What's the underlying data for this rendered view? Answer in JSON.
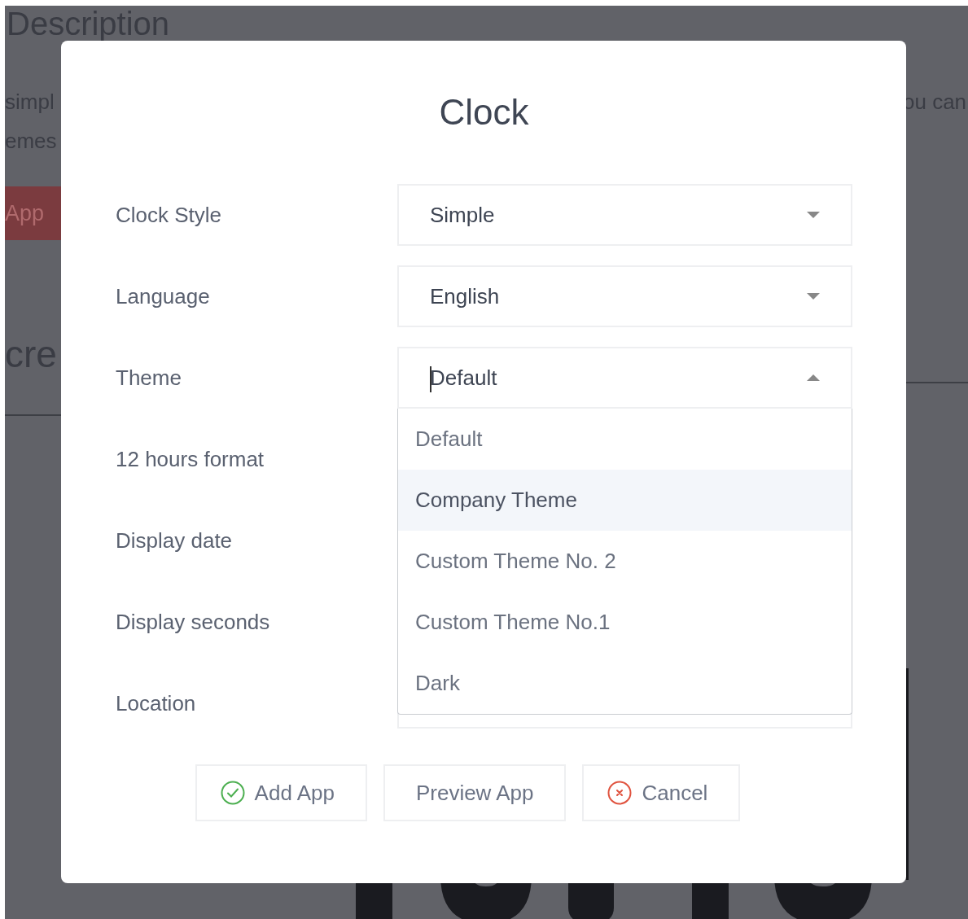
{
  "background": {
    "heading": "Description",
    "left_texts": [
      "simpl",
      "emes"
    ],
    "button": "App",
    "subheading": "cre",
    "right_text": "ou can"
  },
  "dialog": {
    "title": "Clock",
    "rows": [
      {
        "label": "Clock Style",
        "field": {
          "kind": "select",
          "value": "Simple",
          "open": false
        }
      },
      {
        "label": "Language",
        "field": {
          "kind": "select",
          "value": "English",
          "open": false
        }
      },
      {
        "label": "Theme",
        "field": {
          "kind": "select",
          "value": "Default",
          "open": true,
          "options": [
            {
              "label": "Default",
              "highlighted": false
            },
            {
              "label": "Company Theme",
              "highlighted": true
            },
            {
              "label": "Custom Theme No. 2",
              "highlighted": false
            },
            {
              "label": "Custom Theme No.1",
              "highlighted": false
            },
            {
              "label": "Dark",
              "highlighted": false
            }
          ]
        }
      },
      {
        "label": "12 hours format"
      },
      {
        "label": "Display date"
      },
      {
        "label": "Display seconds"
      },
      {
        "label": "Location"
      }
    ],
    "buttons": [
      {
        "label": "Add App",
        "kind": "confirm"
      },
      {
        "label": "Preview App",
        "kind": "plain"
      },
      {
        "label": "Cancel",
        "kind": "cancel"
      }
    ]
  }
}
